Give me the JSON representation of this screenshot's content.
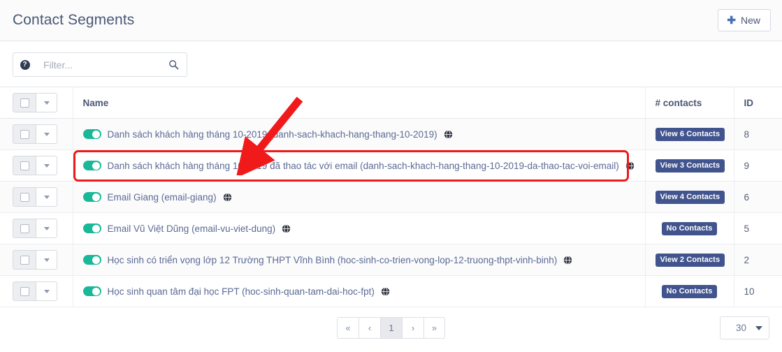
{
  "header": {
    "title": "Contact Segments",
    "new_button": "New",
    "new_icon": "plus-icon"
  },
  "filter": {
    "help_icon": "help-circle-icon",
    "placeholder": "Filter...",
    "value": "",
    "search_icon": "search-icon"
  },
  "table": {
    "columns": {
      "select": "",
      "name": "Name",
      "contacts": "# contacts",
      "id": "ID"
    },
    "rows": [
      {
        "name": "Danh sách khách hàng tháng 10-2019 (danh-sach-khach-hang-thang-10-2019)",
        "contacts_label": "View 6 Contacts",
        "id": "8",
        "toggle": "on",
        "globe_icon": "globe-icon"
      },
      {
        "name": "Danh sách khách hàng tháng 10-2019 đã thao tác với email (danh-sach-khach-hang-thang-10-2019-da-thao-tac-voi-email)",
        "contacts_label": "View 3 Contacts",
        "id": "9",
        "toggle": "on",
        "globe_icon": "globe-icon"
      },
      {
        "name": "Email Giang (email-giang)",
        "contacts_label": "View 4 Contacts",
        "id": "6",
        "toggle": "on",
        "globe_icon": "globe-icon"
      },
      {
        "name": "Email Vũ Việt Dũng (email-vu-viet-dung)",
        "contacts_label": "No Contacts",
        "id": "5",
        "toggle": "on",
        "globe_icon": "globe-icon"
      },
      {
        "name": "Học sinh có triển vọng lớp 12 Trường THPT Vĩnh Bình (hoc-sinh-co-trien-vong-lop-12-truong-thpt-vinh-binh)",
        "contacts_label": "View 2 Contacts",
        "id": "2",
        "toggle": "on",
        "globe_icon": "globe-icon"
      },
      {
        "name": "Học sinh quan tâm đại học FPT (hoc-sinh-quan-tam-dai-hoc-fpt)",
        "contacts_label": "No Contacts",
        "id": "10",
        "toggle": "on",
        "globe_icon": "globe-icon"
      }
    ]
  },
  "pagination": {
    "first": "«",
    "prev": "‹",
    "current": "1",
    "next": "›",
    "last": "»"
  },
  "page_size": {
    "value": "30",
    "caret_icon": "chevron-down-icon"
  },
  "annotations": {
    "highlight_row_index": 1,
    "arrow_icon": "red-arrow-icon",
    "accent_color": "#f01a1a"
  },
  "colors": {
    "badge": "#41548e",
    "toggle_on": "#18b899",
    "title": "#4a5875",
    "link": "#5b6a93"
  }
}
